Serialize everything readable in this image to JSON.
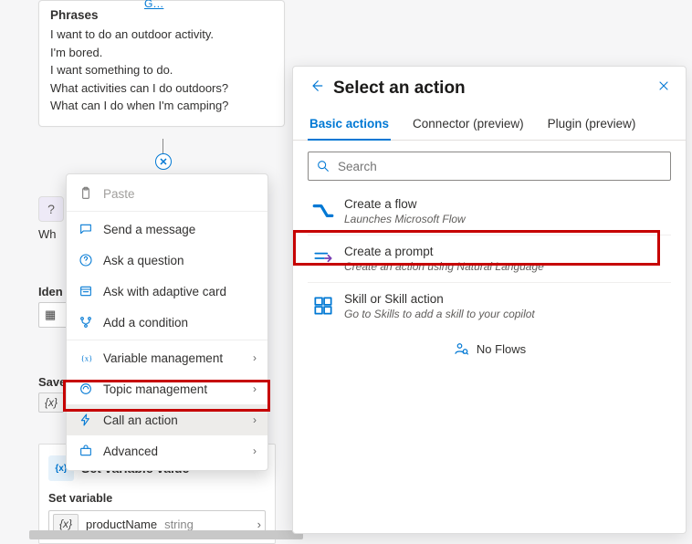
{
  "phrases": {
    "title": "Phrases",
    "items": [
      "I want to do an outdoor activity.",
      "I'm bored.",
      "I want something to do.",
      "What activities can I do outdoors?",
      "What can I do when I'm camping?"
    ],
    "g_link": "G…"
  },
  "faded": {
    "what_label": "Wh",
    "ident_label": "Iden",
    "save_label": "Save"
  },
  "set_var": {
    "header": "Set variable value",
    "sub": "Set variable",
    "var_name": "productName",
    "var_type": "string"
  },
  "context_menu": {
    "paste": "Paste",
    "send_message": "Send a message",
    "ask_question": "Ask a question",
    "ask_adaptive": "Ask with adaptive card",
    "add_condition": "Add a condition",
    "variable_mgmt": "Variable management",
    "topic_mgmt": "Topic management",
    "call_action": "Call an action",
    "advanced": "Advanced"
  },
  "panel": {
    "title": "Select an action",
    "tabs": {
      "basic": "Basic actions",
      "connector": "Connector (preview)",
      "plugin": "Plugin (preview)"
    },
    "search_placeholder": "Search",
    "actions": {
      "flow": {
        "title": "Create a flow",
        "desc": "Launches Microsoft Flow"
      },
      "prompt": {
        "title": "Create a prompt",
        "desc": "Create an action using Natural Language"
      },
      "skill": {
        "title": "Skill or Skill action",
        "desc": "Go to Skills to add a skill to your copilot"
      }
    },
    "no_flows": "No Flows"
  }
}
